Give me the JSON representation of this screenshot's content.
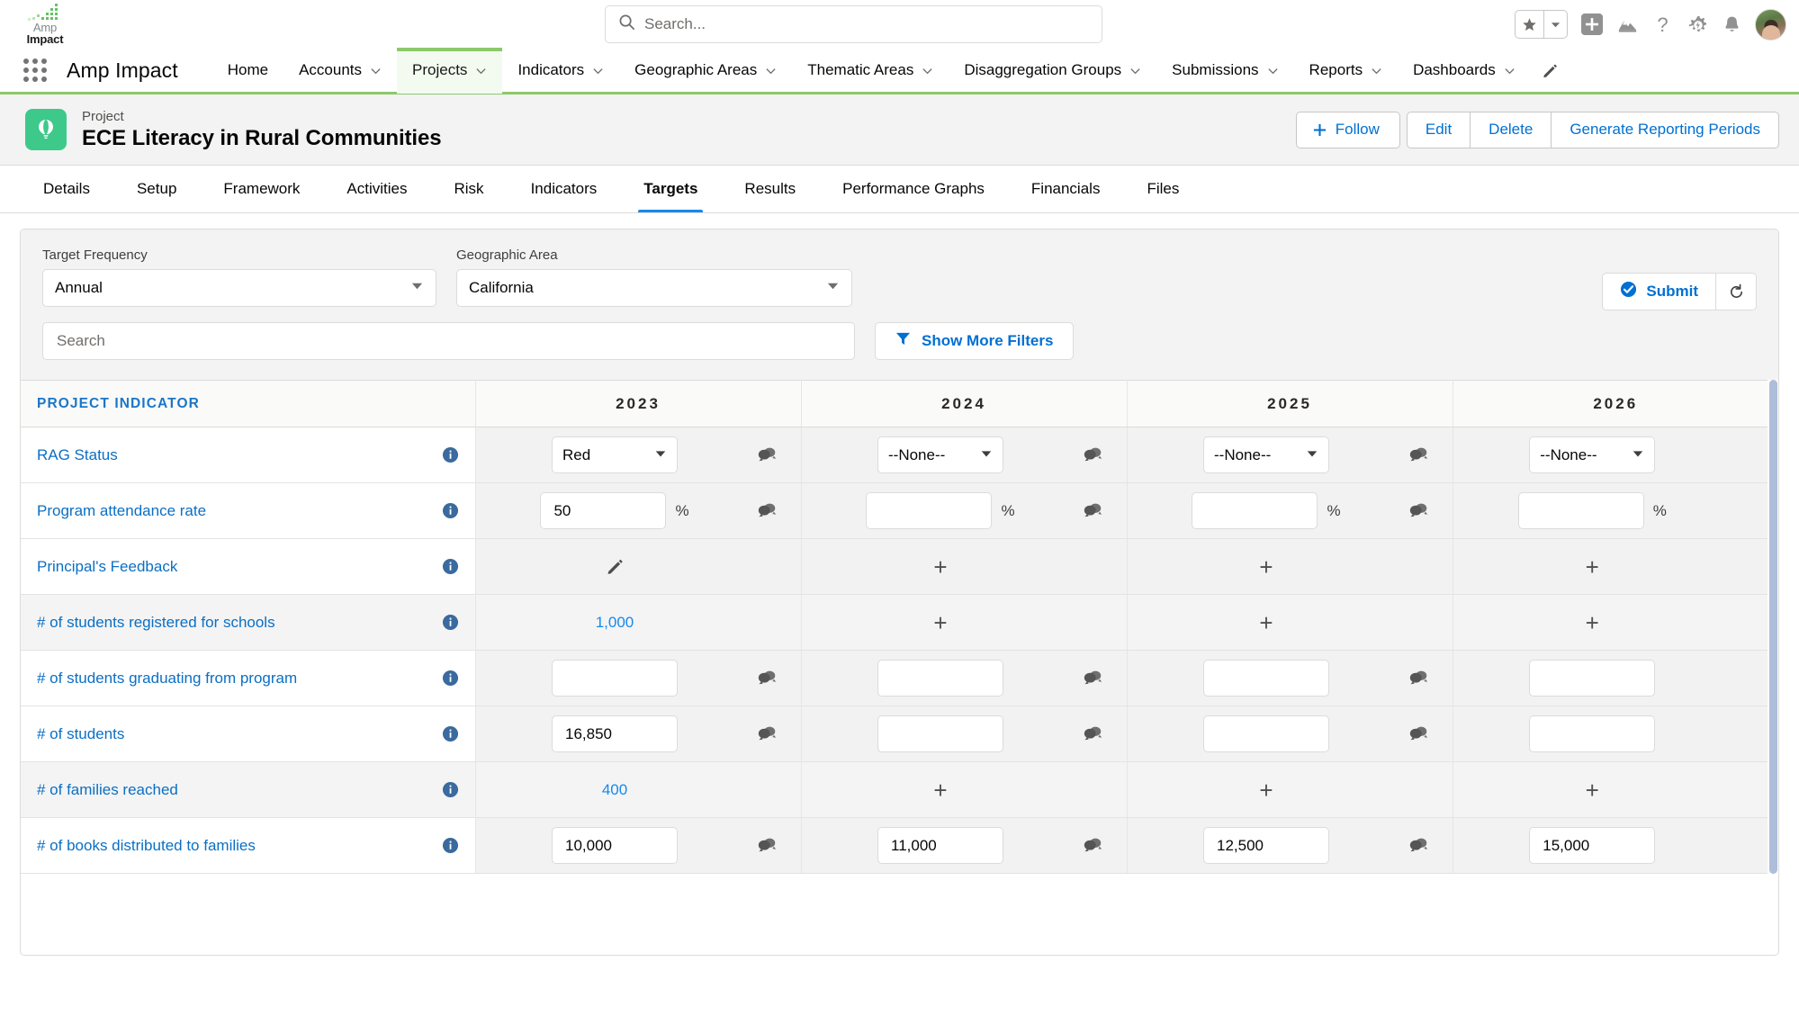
{
  "global": {
    "brand": {
      "line1": "Amp",
      "line2": "Impact"
    },
    "search_placeholder": "Search...",
    "icons": {
      "favorites": "star-icon",
      "favorites_caret": "chevron-down-icon",
      "add": "plus-square-icon",
      "setup_assistant": "mountain-icon",
      "help": "question-mark-icon",
      "setup": "gear-icon",
      "notifications": "bell-icon",
      "avatar": "user-avatar"
    }
  },
  "app_nav": {
    "app_name": "Amp Impact",
    "items": [
      {
        "label": "Home",
        "has_caret": false,
        "active": false
      },
      {
        "label": "Accounts",
        "has_caret": true,
        "active": false
      },
      {
        "label": "Projects",
        "has_caret": true,
        "active": true
      },
      {
        "label": "Indicators",
        "has_caret": true,
        "active": false
      },
      {
        "label": "Geographic Areas",
        "has_caret": true,
        "active": false
      },
      {
        "label": "Thematic Areas",
        "has_caret": true,
        "active": false
      },
      {
        "label": "Disaggregation Groups",
        "has_caret": true,
        "active": false
      },
      {
        "label": "Submissions",
        "has_caret": true,
        "active": false
      },
      {
        "label": "Reports",
        "has_caret": true,
        "active": false
      },
      {
        "label": "Dashboards",
        "has_caret": true,
        "active": false
      }
    ],
    "edit_icon": "pencil-icon"
  },
  "record": {
    "type_label": "Project",
    "title": "ECE Literacy in Rural Communities",
    "icon": "hot-air-balloon-icon",
    "icon_color": "#3dc98a",
    "actions": {
      "follow": "Follow",
      "edit": "Edit",
      "delete": "Delete",
      "generate": "Generate Reporting Periods"
    }
  },
  "tabs": [
    {
      "label": "Details",
      "active": false
    },
    {
      "label": "Setup",
      "active": false
    },
    {
      "label": "Framework",
      "active": false
    },
    {
      "label": "Activities",
      "active": false
    },
    {
      "label": "Risk",
      "active": false
    },
    {
      "label": "Indicators",
      "active": false
    },
    {
      "label": "Targets",
      "active": true
    },
    {
      "label": "Results",
      "active": false
    },
    {
      "label": "Performance Graphs",
      "active": false
    },
    {
      "label": "Financials",
      "active": false
    },
    {
      "label": "Files",
      "active": false
    }
  ],
  "filters": {
    "frequency_label": "Target Frequency",
    "frequency_value": "Annual",
    "geo_label": "Geographic Area",
    "geo_value": "California",
    "search_placeholder": "Search",
    "search_value": "",
    "show_more_filters": "Show More Filters",
    "submit": "Submit",
    "refresh_icon": "refresh-icon",
    "filter_icon": "funnel-icon",
    "submit_icon": "check-circle-icon"
  },
  "table": {
    "indicator_header": "PROJECT INDICATOR",
    "year_columns": [
      "2023",
      "2024",
      "2025",
      "2026"
    ],
    "rows": [
      {
        "label": "RAG Status",
        "shaded": false,
        "cells": [
          {
            "type": "dropdown",
            "value": "Red",
            "comment": true
          },
          {
            "type": "dropdown",
            "value": "--None--",
            "comment": true
          },
          {
            "type": "dropdown",
            "value": "--None--",
            "comment": true
          },
          {
            "type": "dropdown",
            "value": "--None--",
            "comment": false
          }
        ]
      },
      {
        "label": "Program attendance rate",
        "shaded": false,
        "cells": [
          {
            "type": "input",
            "value": "50",
            "suffix": "%",
            "comment": true
          },
          {
            "type": "input",
            "value": "",
            "suffix": "%",
            "comment": true
          },
          {
            "type": "input",
            "value": "",
            "suffix": "%",
            "comment": true
          },
          {
            "type": "input",
            "value": "",
            "suffix": "%",
            "comment": false
          }
        ]
      },
      {
        "label": "Principal's Feedback",
        "shaded": false,
        "cells": [
          {
            "type": "pencil",
            "value": "",
            "comment": false
          },
          {
            "type": "plus",
            "value": "+",
            "comment": false
          },
          {
            "type": "plus",
            "value": "+",
            "comment": false
          },
          {
            "type": "plus",
            "value": "+",
            "comment": false
          }
        ]
      },
      {
        "label": "# of students registered for schools",
        "shaded": true,
        "cells": [
          {
            "type": "link",
            "value": "1,000",
            "comment": false
          },
          {
            "type": "plus",
            "value": "+",
            "comment": false
          },
          {
            "type": "plus",
            "value": "+",
            "comment": false
          },
          {
            "type": "plus",
            "value": "+",
            "comment": false
          }
        ]
      },
      {
        "label": "# of students graduating from program",
        "shaded": false,
        "cells": [
          {
            "type": "input",
            "value": "",
            "comment": true
          },
          {
            "type": "input",
            "value": "",
            "comment": true
          },
          {
            "type": "input",
            "value": "",
            "comment": true
          },
          {
            "type": "input",
            "value": "",
            "comment": false
          }
        ]
      },
      {
        "label": "# of students",
        "shaded": false,
        "cells": [
          {
            "type": "input",
            "value": "16,850",
            "comment": true
          },
          {
            "type": "input",
            "value": "",
            "comment": true
          },
          {
            "type": "input",
            "value": "",
            "comment": true
          },
          {
            "type": "input",
            "value": "",
            "comment": false
          }
        ]
      },
      {
        "label": "# of families reached",
        "shaded": true,
        "cells": [
          {
            "type": "link",
            "value": "400",
            "comment": false
          },
          {
            "type": "plus",
            "value": "+",
            "comment": false
          },
          {
            "type": "plus",
            "value": "+",
            "comment": false
          },
          {
            "type": "plus",
            "value": "+",
            "comment": false
          }
        ]
      },
      {
        "label": "# of books distributed to families",
        "shaded": false,
        "cells": [
          {
            "type": "input",
            "value": "10,000",
            "comment": true
          },
          {
            "type": "input",
            "value": "11,000",
            "comment": true
          },
          {
            "type": "input",
            "value": "12,500",
            "comment": true
          },
          {
            "type": "input",
            "value": "15,000",
            "comment": false
          }
        ]
      }
    ]
  }
}
